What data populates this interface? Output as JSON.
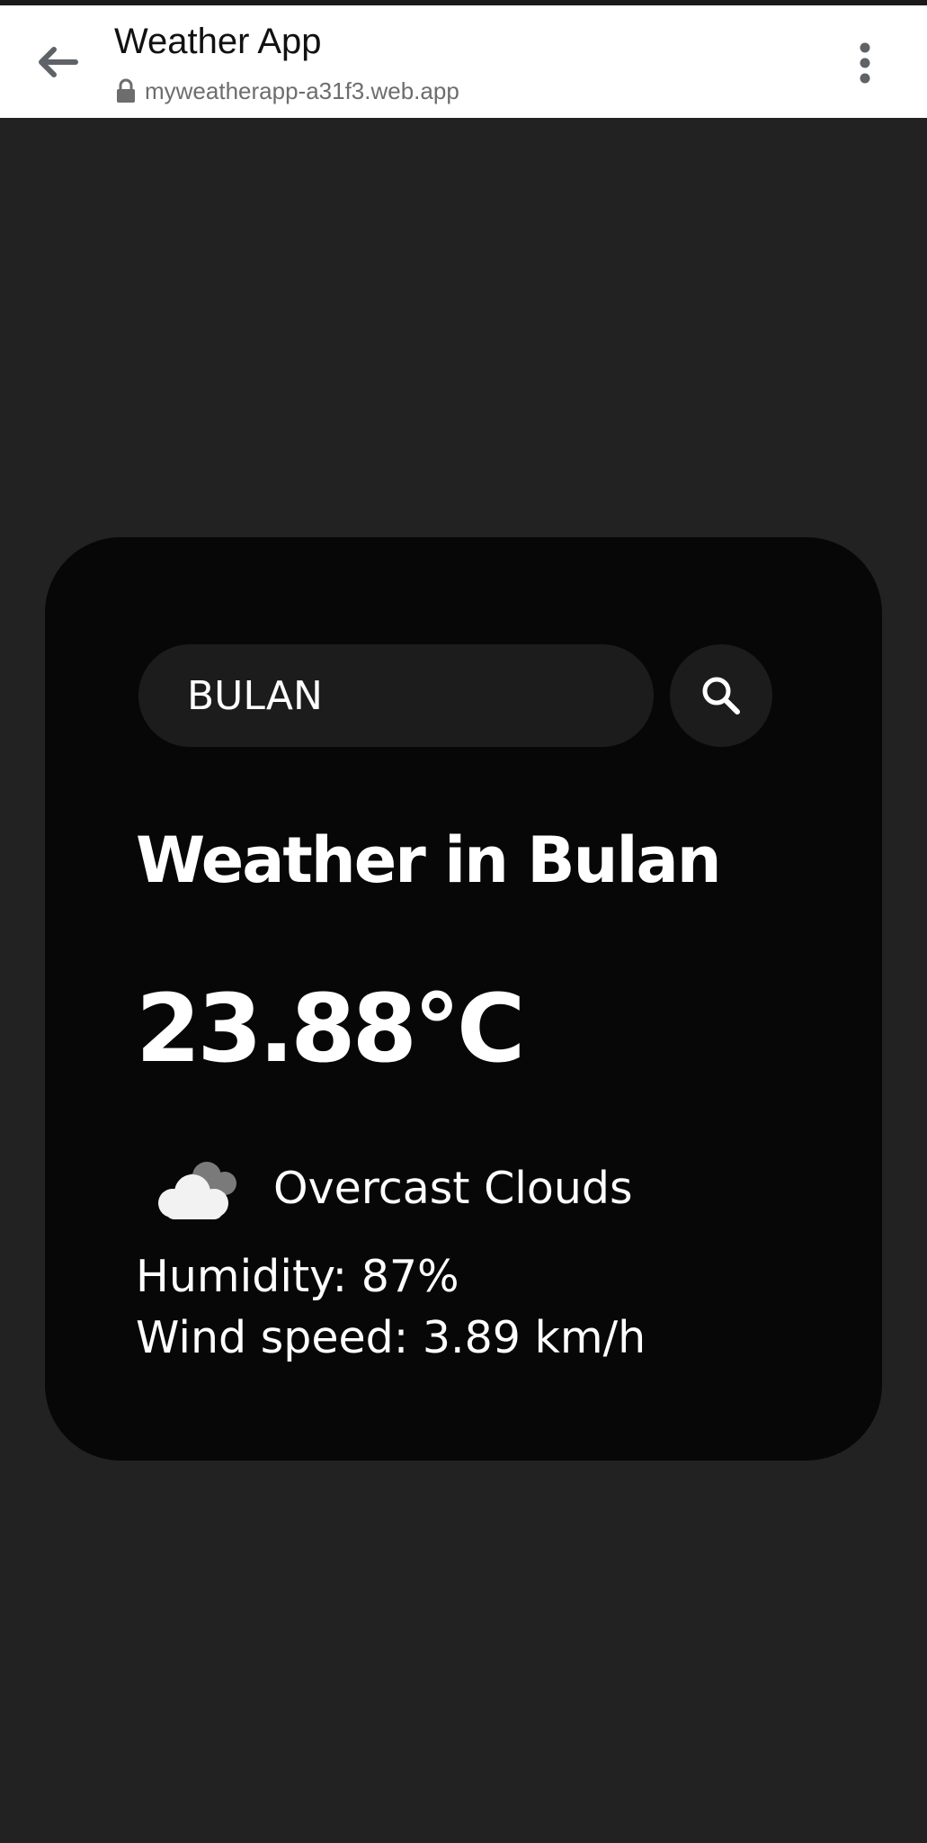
{
  "browser": {
    "title": "Weather App",
    "url": "myweatherapp-a31f3.web.app",
    "icons": {
      "back": "arrow-left",
      "secure": "lock",
      "menu": "more-vertical"
    }
  },
  "search": {
    "value": "BULAN",
    "button_icon": "search"
  },
  "weather": {
    "title": "Weather in Bulan",
    "temperature": "23.88°C",
    "condition_icon": "cloud",
    "description": "Overcast Clouds",
    "humidity": "Humidity: 87%",
    "wind": "Wind speed: 3.89 km/h"
  },
  "colors": {
    "page_background": "#222222",
    "card_background": "#070707",
    "input_background": "#1c1c1c",
    "text": "#ffffff",
    "toolbar": "#ffffff"
  }
}
